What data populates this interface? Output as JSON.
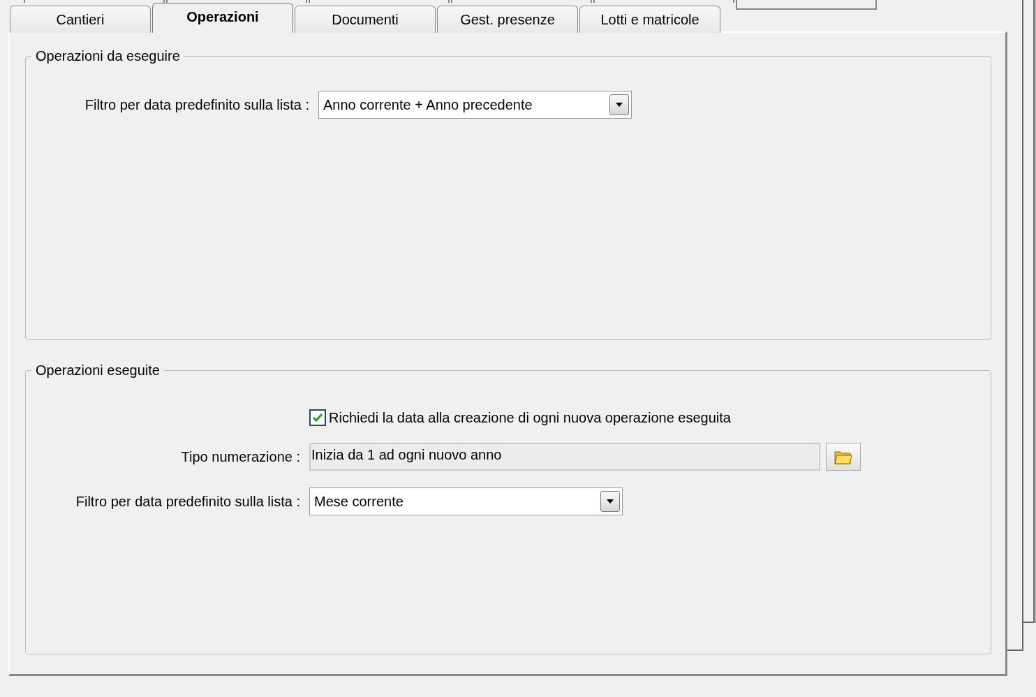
{
  "tabs": [
    {
      "label": "Cantieri",
      "selected": false
    },
    {
      "label": "Operazioni",
      "selected": true
    },
    {
      "label": "Documenti",
      "selected": false
    },
    {
      "label": "Gest. presenze",
      "selected": false
    },
    {
      "label": "Lotti e matricole",
      "selected": false
    }
  ],
  "groups": [
    {
      "title": "Operazioni da eseguire",
      "rows": [
        {
          "kind": "combo",
          "label": "Filtro per data predefinito sulla lista :",
          "value": "Anno corrente + Anno precedente"
        }
      ]
    },
    {
      "title": "Operazioni eseguite",
      "rows": [
        {
          "kind": "checkbox",
          "label": "Richiedi la data alla creazione di ogni nuova operazione eseguita",
          "checked": true
        },
        {
          "kind": "browse",
          "label": "Tipo numerazione :",
          "value": "Inizia da 1 ad ogni nuovo anno"
        },
        {
          "kind": "combo",
          "label": "Filtro per data predefinito sulla lista :",
          "value": "Mese corrente"
        }
      ]
    }
  ]
}
